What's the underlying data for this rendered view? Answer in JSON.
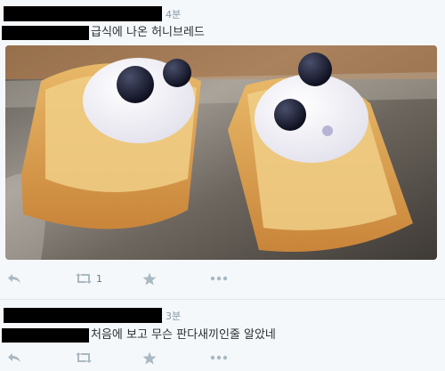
{
  "tweets": [
    {
      "time": "4분",
      "text": "급식에 나온 허니브레드",
      "actions": {
        "reply_icon": "reply-icon",
        "retweet_icon": "retweet-icon",
        "retweet_count": "1",
        "favorite_icon": "star-icon",
        "more_icon": "more-icon"
      }
    },
    {
      "time": "3분",
      "text": "처음에 보고 무슨 판다새끼인줄 알았네",
      "actions": {
        "reply_icon": "reply-icon",
        "retweet_icon": "retweet-icon",
        "retweet_count": "",
        "favorite_icon": "star-icon",
        "more_icon": "more-icon"
      }
    }
  ],
  "colors": {
    "background": "#f5f8fa",
    "icon": "#aab8c2",
    "text": "#292f33",
    "meta": "#8899a6"
  }
}
